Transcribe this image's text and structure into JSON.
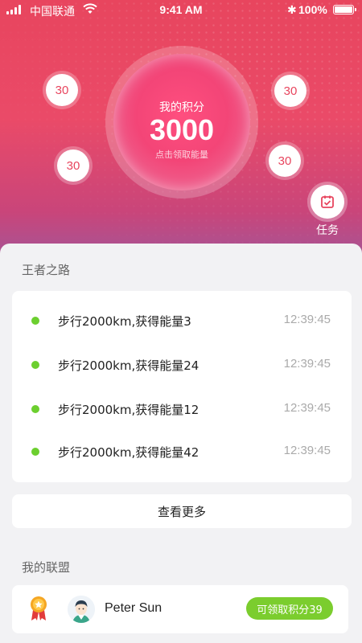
{
  "status_bar": {
    "carrier": "中国联通",
    "time": "9:41 AM",
    "battery": "100%",
    "signal_icon": "signal-bars-icon",
    "wifi_icon": "wifi-icon",
    "bluetooth_icon": "bluetooth-icon"
  },
  "score": {
    "label": "我的积分",
    "value": "3000",
    "hint": "点击领取能量"
  },
  "bubbles": [
    "30",
    "30",
    "30",
    "30"
  ],
  "task": {
    "label": "任务",
    "icon": "task-calendar-icon"
  },
  "records_section": {
    "title": "王者之路",
    "items": [
      {
        "text": "步行2000km,获得能量3",
        "time": "12:39:45"
      },
      {
        "text": "步行2000km,获得能量24",
        "time": "12:39:45"
      },
      {
        "text": "步行2000km,获得能量12",
        "time": "12:39:45"
      },
      {
        "text": "步行2000km,获得能量42",
        "time": "12:39:45"
      }
    ],
    "more_label": "查看更多"
  },
  "alliance_section": {
    "title": "我的联盟",
    "member": {
      "name": "Peter Sun",
      "claim_label": "可领取积分39"
    }
  },
  "colors": {
    "accent": "#e8455e",
    "green": "#7bcd2e",
    "dot": "#6ccf2f"
  }
}
